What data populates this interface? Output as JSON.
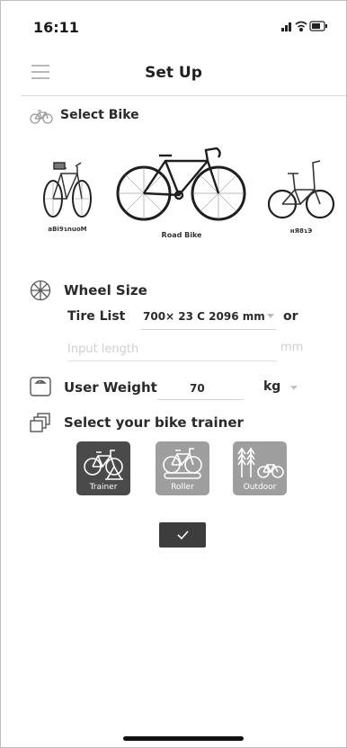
{
  "status_bar": {
    "time": "16:11"
  },
  "header": {
    "title": "Set Up"
  },
  "select_bike": {
    "label": "Select Bike",
    "options": [
      {
        "caption": "aBi9ɿnuoM",
        "icon": "mountain-bike-icon"
      },
      {
        "caption": "Road Bike",
        "icon": "road-bike-icon"
      },
      {
        "caption": "ʜЯ8ɿЭ",
        "icon": "folding-bike-icon"
      }
    ]
  },
  "wheel_size": {
    "label": "Wheel Size",
    "tire_list_label": "Tire List",
    "tire_value": "700× 23 C 2096 mm",
    "or_label": "or",
    "input_placeholder": "Input length",
    "unit": "mm"
  },
  "user_weight": {
    "label": "User Weight",
    "value": "70",
    "unit": "kg"
  },
  "bike_trainer": {
    "label": "Select your bike trainer",
    "options": [
      {
        "label": "Trainer",
        "selected": true
      },
      {
        "label": "Roller",
        "selected": false
      },
      {
        "label": "Outdoor",
        "selected": false
      }
    ]
  },
  "colors": {
    "selected": "#4a4a4a",
    "unselected": "#9e9e9e",
    "confirm": "#3d3d3d"
  }
}
